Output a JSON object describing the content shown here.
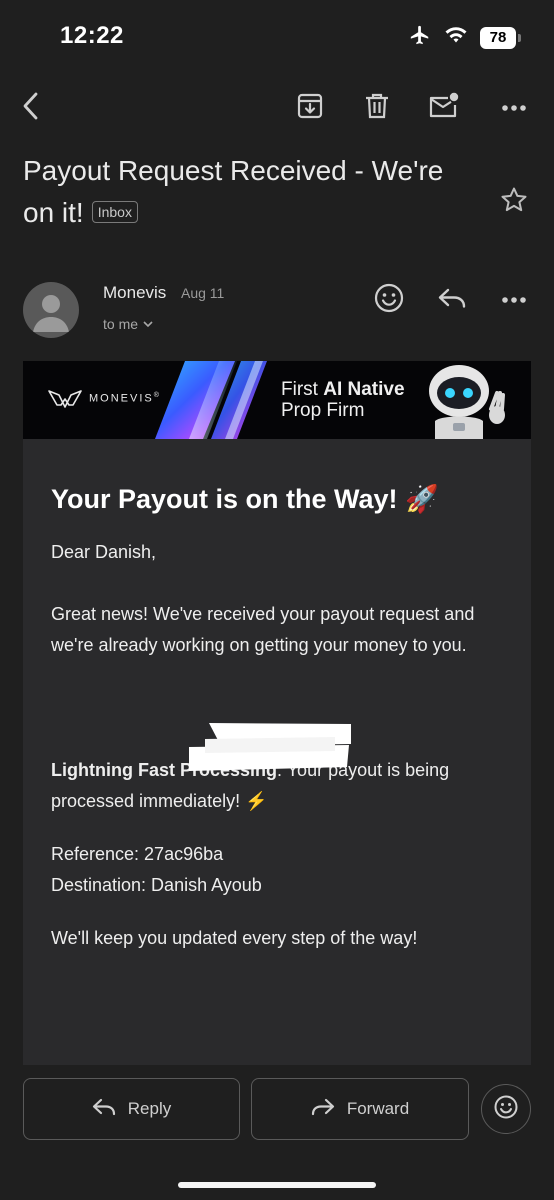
{
  "status": {
    "time": "12:22",
    "battery": "78"
  },
  "email": {
    "subject": "Payout Request Received - We're on it!",
    "label": "Inbox",
    "sender": "Monevis",
    "date": "Aug 11",
    "recipient": "to me"
  },
  "banner": {
    "brand": "MONEVIS",
    "registered": "®",
    "tagline_pre": "First ",
    "tagline_bold": "AI Native",
    "tagline_line2": "Prop Firm"
  },
  "body": {
    "title": "Your Payout is on the Way! 🚀",
    "greeting": "Dear Danish,",
    "intro": "Great news! We've received your payout request and we're already working on getting your money to you.",
    "processing_label": "Lightning Fast Processing",
    "processing_text": ": Your payout is being processed immediately! ⚡",
    "reference": "Reference: 27ac96ba",
    "destination": "Destination: Danish Ayoub",
    "closing": "We'll keep you updated every step of the way!"
  },
  "actions": {
    "reply": "Reply",
    "forward": "Forward"
  },
  "colors": {
    "background": "#1f1f1f",
    "card": "#2a2a2c",
    "banner": "#050507"
  },
  "icons": [
    "back-icon",
    "archive-icon",
    "trash-icon",
    "mark-unread-icon",
    "more-icon",
    "star-icon",
    "emoji-icon",
    "reply-icon",
    "forward-icon"
  ]
}
